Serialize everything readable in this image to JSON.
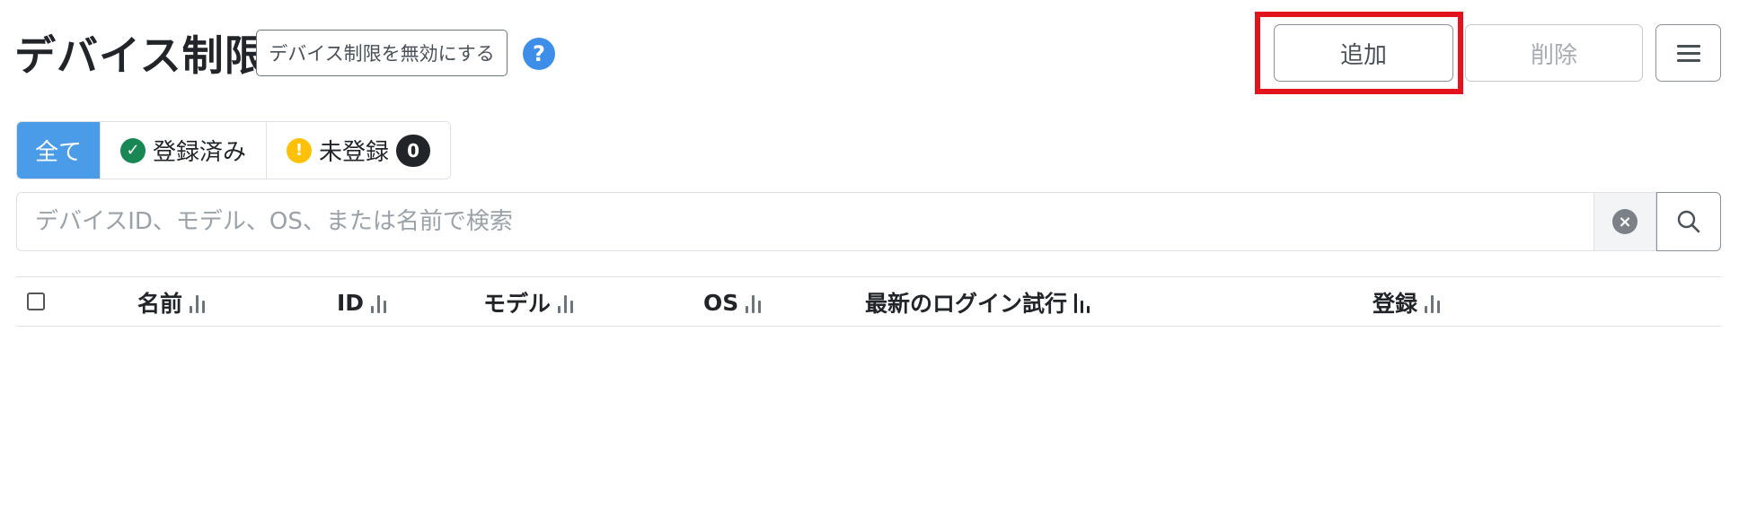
{
  "header": {
    "title": "デバイス制限",
    "disable_button": "デバイス制限を無効にする",
    "help_icon": "?"
  },
  "toolbar": {
    "add_label": "追加",
    "delete_label": "削除",
    "menu_icon": "hamburger-menu-icon"
  },
  "filters": {
    "all": "全て",
    "registered": "登録済み",
    "unregistered": "未登録",
    "unregistered_count": "0"
  },
  "search": {
    "placeholder": "デバイスID、モデル、OS、または名前で検索"
  },
  "table": {
    "columns": [
      {
        "label": "名前"
      },
      {
        "label": "ID"
      },
      {
        "label": "モデル"
      },
      {
        "label": "OS"
      },
      {
        "label": "最新のログイン試行"
      },
      {
        "label": "登録"
      }
    ]
  },
  "colors": {
    "accent": "#4a9ce8",
    "highlight": "#e3131e",
    "success": "#198754",
    "warning": "#ffc107"
  }
}
